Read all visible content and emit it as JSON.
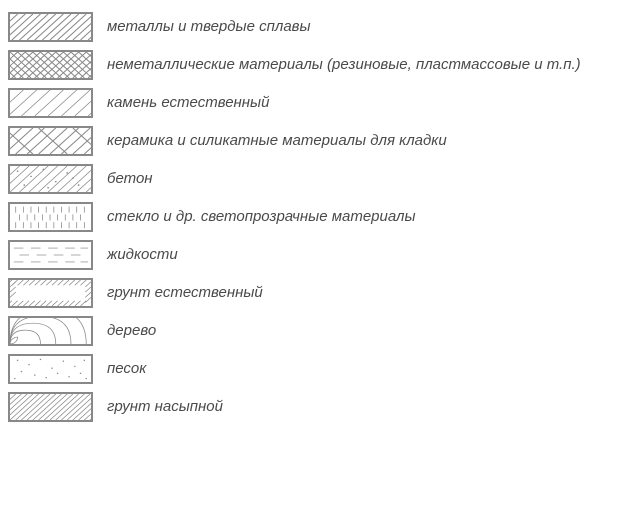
{
  "legend": {
    "items": [
      {
        "label": "металлы и твердые сплавы"
      },
      {
        "label": "неметаллические материалы (резиновые, пластмассовые и т.п.)"
      },
      {
        "label": "камень естественный"
      },
      {
        "label": "керамика и силикатные материалы для кладки"
      },
      {
        "label": "бетон"
      },
      {
        "label": "стекло и др. светопрозрачные материалы"
      },
      {
        "label": "жидкости"
      },
      {
        "label": "грунт естественный"
      },
      {
        "label": "дерево"
      },
      {
        "label": "песок"
      },
      {
        "label": "грунт насыпной"
      }
    ]
  }
}
